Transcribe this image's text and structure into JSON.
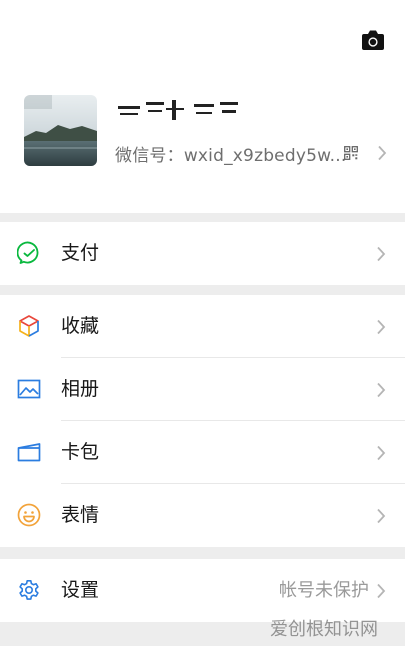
{
  "profile": {
    "wechat_id_label": "微信号：",
    "wechat_id": "wxid_x9zbedy5w..."
  },
  "groups": {
    "pay": {
      "label": "支付"
    },
    "favorites": {
      "label": "收藏"
    },
    "album": {
      "label": "相册"
    },
    "cards": {
      "label": "卡包"
    },
    "stickers": {
      "label": "表情"
    },
    "settings": {
      "label": "设置",
      "value": "帐号未保护"
    }
  },
  "watermark": "爱创根知识网",
  "colors": {
    "pay_green": "#09b83e",
    "settings_blue": "#2b7de0",
    "sticker_orange": "#f2a33a",
    "chevron": "#b5b5b5"
  },
  "icons": [
    "camera-icon",
    "qr-code-icon",
    "wallet-check-icon",
    "cube-icon",
    "image-icon",
    "card-icon",
    "smiley-icon",
    "gear-icon",
    "chevron-right-icon"
  ]
}
